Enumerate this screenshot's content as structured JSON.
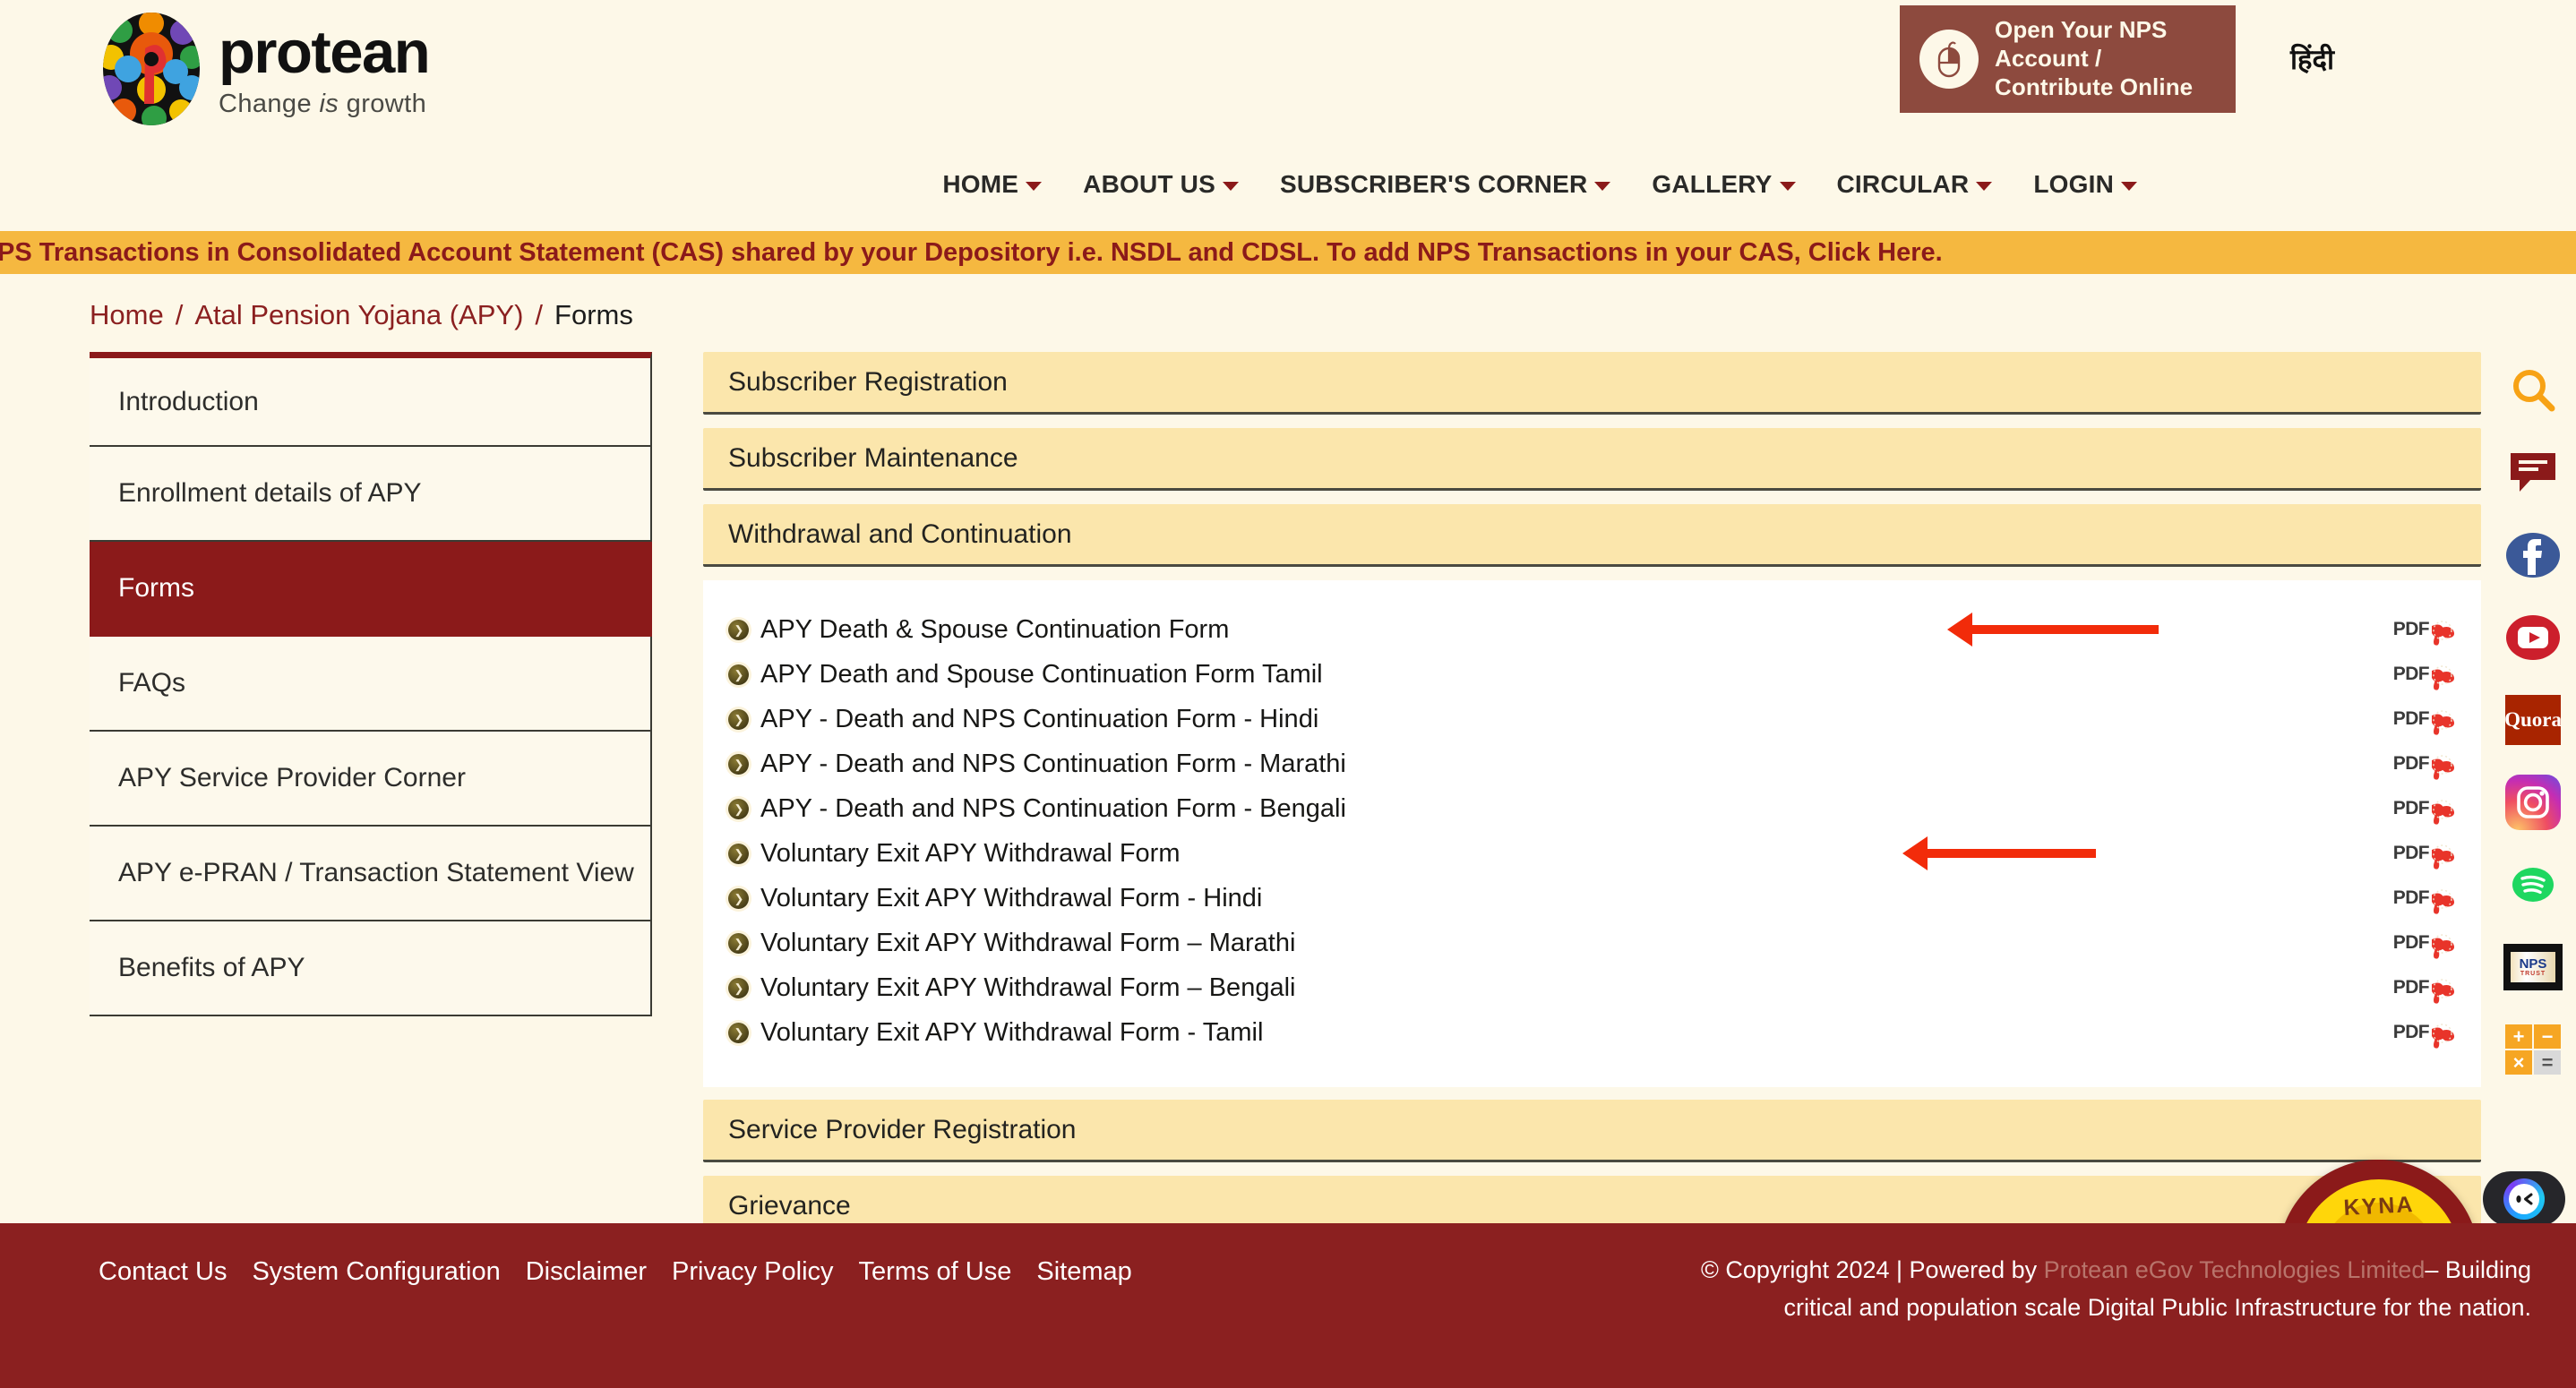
{
  "header": {
    "logo_word": "protean",
    "logo_tagline_pre": "Change ",
    "logo_tagline_em": "is",
    "logo_tagline_post": " growth",
    "nps_button_line1": "Open Your NPS Account /",
    "nps_button_line2": "Contribute Online",
    "hindi_label": "हिंदी"
  },
  "nav": {
    "items": [
      {
        "label": "HOME"
      },
      {
        "label": "ABOUT US"
      },
      {
        "label": "SUBSCRIBER'S CORNER"
      },
      {
        "label": "GALLERY"
      },
      {
        "label": "CIRCULAR"
      },
      {
        "label": "LOGIN"
      }
    ]
  },
  "ticker": {
    "text": "Now view your NPS Transactions in Consolidated Account Statement (CAS) shared by your Depository i.e. NSDL and CDSL. To add NPS Transactions in your CAS, Click Here."
  },
  "breadcrumb": {
    "home": "Home",
    "sep": "/",
    "parent": "Atal Pension Yojana (APY)",
    "current": "Forms"
  },
  "sidebar": {
    "items": [
      {
        "label": "Introduction",
        "active": false
      },
      {
        "label": "Enrollment details of APY",
        "active": false
      },
      {
        "label": "Forms",
        "active": true
      },
      {
        "label": "FAQs",
        "active": false
      },
      {
        "label": "APY Service Provider Corner",
        "active": false
      },
      {
        "label": "APY e-PRAN / Transaction Statement View",
        "active": false
      },
      {
        "label": "Benefits of APY",
        "active": false
      }
    ]
  },
  "main": {
    "sections": [
      {
        "title": "Subscriber Registration"
      },
      {
        "title": "Subscriber Maintenance"
      },
      {
        "title": "Withdrawal and Continuation"
      },
      {
        "title": "Service Provider Registration"
      },
      {
        "title": "Grievance"
      }
    ],
    "pdf_label": "PDF",
    "forms": [
      {
        "label": "APY Death & Spouse Continuation Form",
        "pdf": "PDF",
        "annotated": true
      },
      {
        "label": "APY Death and Spouse Continuation Form Tamil",
        "pdf": "PDF",
        "annotated": false
      },
      {
        "label": "APY - Death and NPS Continuation Form - Hindi",
        "pdf": "PDF",
        "annotated": false
      },
      {
        "label": "APY - Death and NPS Continuation Form - Marathi",
        "pdf": "PDF",
        "annotated": false
      },
      {
        "label": "APY - Death and NPS Continuation Form - Bengali",
        "pdf": "PDF",
        "annotated": false
      },
      {
        "label": "Voluntary Exit APY Withdrawal Form",
        "pdf": "PDF",
        "annotated": true
      },
      {
        "label": "Voluntary Exit APY Withdrawal Form - Hindi",
        "pdf": "PDF",
        "annotated": false
      },
      {
        "label": "Voluntary Exit APY Withdrawal Form – Marathi",
        "pdf": "PDF",
        "annotated": false
      },
      {
        "label": "Voluntary Exit APY Withdrawal Form – Bengali",
        "pdf": "PDF",
        "annotated": false
      },
      {
        "label": "Voluntary Exit APY Withdrawal Form - Tamil",
        "pdf": "PDF",
        "annotated": false
      }
    ]
  },
  "rail": {
    "items": [
      {
        "name": "search-icon",
        "label": ""
      },
      {
        "name": "chat-icon",
        "label": ""
      },
      {
        "name": "facebook-icon",
        "label": "f"
      },
      {
        "name": "youtube-icon",
        "label": ""
      },
      {
        "name": "quora-icon",
        "label": "Quora"
      },
      {
        "name": "instagram-icon",
        "label": ""
      },
      {
        "name": "spotify-icon",
        "label": ""
      },
      {
        "name": "nps-trust-icon",
        "label": "NPS"
      },
      {
        "name": "calculator-icon",
        "label": ""
      }
    ],
    "nps_trust_sub": "TRUST",
    "calc_keys": [
      "+",
      "−",
      "×",
      "="
    ]
  },
  "widgets": {
    "kyna_label": "KYNA"
  },
  "footer": {
    "links": [
      {
        "label": "Contact Us"
      },
      {
        "label": "System Configuration"
      },
      {
        "label": "Disclaimer"
      },
      {
        "label": "Privacy Policy"
      },
      {
        "label": "Terms of Use"
      },
      {
        "label": "Sitemap"
      }
    ],
    "copyright_pre": "© Copyright 2024 | Powered by ",
    "company": "Protean eGov Technologies Limited",
    "copyright_post": "– Building",
    "copyright_line2": "critical and population scale Digital Public Infrastructure for the nation."
  },
  "colors": {
    "brand_maroon": "#8b1a1a",
    "footer_maroon": "#8b2020",
    "cream": "#fdf8e8",
    "accordion": "#fbe6ac",
    "ticker": "#f5b840",
    "annotation_red": "#f22b0a"
  }
}
